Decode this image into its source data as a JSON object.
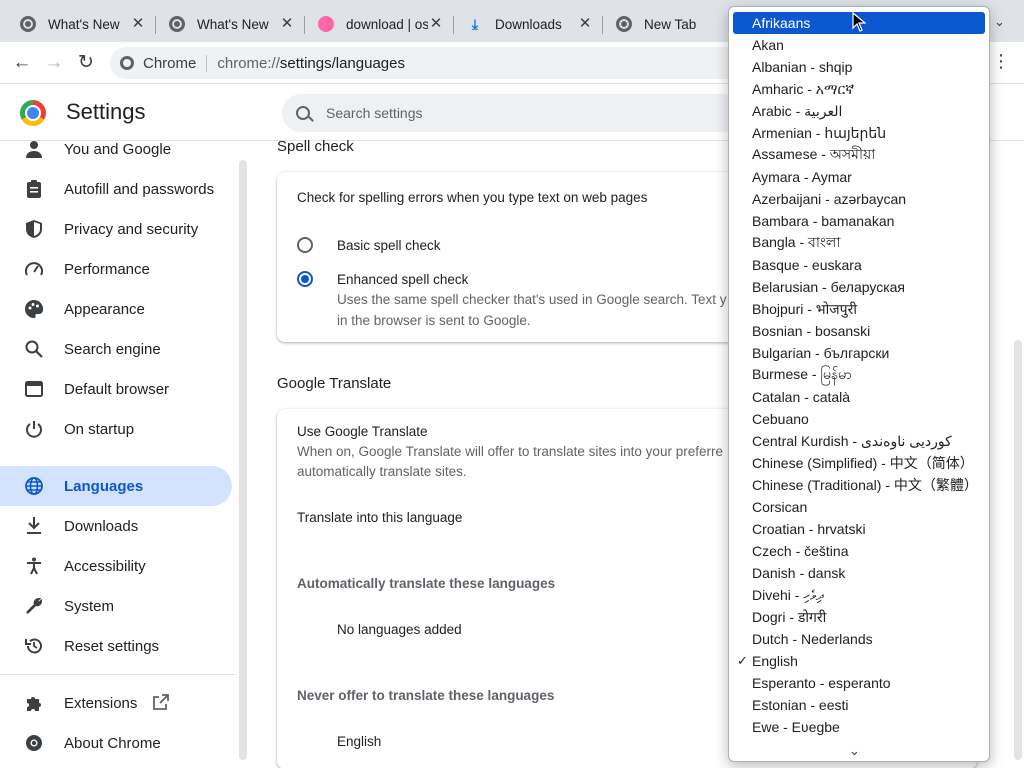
{
  "tabs": [
    {
      "title": "What's New",
      "favicon": "chrome-icon"
    },
    {
      "title": "What's New",
      "favicon": "chrome-icon"
    },
    {
      "title": "download | osu!",
      "favicon": "osu-icon"
    },
    {
      "title": "Downloads",
      "favicon": "download-icon"
    },
    {
      "title": "New Tab",
      "favicon": "chrome-icon"
    }
  ],
  "toolbar": {
    "chip": "Chrome",
    "url_prefix": "chrome://",
    "url_path": "settings/languages"
  },
  "header": {
    "title": "Settings",
    "search_placeholder": "Search settings"
  },
  "sidebar": {
    "items": [
      {
        "label": "You and Google",
        "icon": "person-icon"
      },
      {
        "label": "Autofill and passwords",
        "icon": "clipboard-icon"
      },
      {
        "label": "Privacy and security",
        "icon": "shield-icon"
      },
      {
        "label": "Performance",
        "icon": "gauge-icon"
      },
      {
        "label": "Appearance",
        "icon": "palette-icon"
      },
      {
        "label": "Search engine",
        "icon": "search-icon"
      },
      {
        "label": "Default browser",
        "icon": "browser-icon"
      },
      {
        "label": "On startup",
        "icon": "power-icon"
      },
      {
        "label": "Languages",
        "icon": "globe-icon"
      },
      {
        "label": "Downloads",
        "icon": "download-icon"
      },
      {
        "label": "Accessibility",
        "icon": "accessibility-icon"
      },
      {
        "label": "System",
        "icon": "wrench-icon"
      },
      {
        "label": "Reset settings",
        "icon": "history-icon"
      },
      {
        "label": "Extensions",
        "icon": "puzzle-icon"
      },
      {
        "label": "About Chrome",
        "icon": "chrome-icon"
      }
    ],
    "active": "Languages"
  },
  "spell_check": {
    "title": "Spell check",
    "description": "Check for spelling errors when you type text on web pages",
    "basic_label": "Basic spell check",
    "enhanced_label": "Enhanced spell check",
    "enhanced_desc_1": "Uses the same spell checker that's used in Google search. Text y",
    "enhanced_desc_2": "in the browser is sent to Google."
  },
  "translate": {
    "title": "Google Translate",
    "use_label": "Use Google Translate",
    "use_desc_1": "When on, Google Translate will offer to translate sites into your preferre",
    "use_desc_2": "automatically translate sites.",
    "into_label": "Translate into this language",
    "auto_header": "Automatically translate these languages",
    "auto_empty": "No languages added",
    "never_header": "Never offer to translate these languages",
    "never_item": "English"
  },
  "dropdown": {
    "options": [
      "Afrikaans",
      "Akan",
      "Albanian - shqip",
      "Amharic - አማርኛ",
      "Arabic - العربية",
      "Armenian - հայերեն",
      "Assamese - অসমীয়া",
      "Aymara - Aymar",
      "Azerbaijani - azərbaycan",
      "Bambara - bamanakan",
      "Bangla - বাংলা",
      "Basque - euskara",
      "Belarusian - беларуская",
      "Bhojpuri - भोजपुरी",
      "Bosnian - bosanski",
      "Bulgarian - български",
      "Burmese - မြန်မာ",
      "Catalan - català",
      "Cebuano",
      "Central Kurdish - کوردیی ناوەندی",
      "Chinese (Simplified) - 中文（简体）",
      "Chinese (Traditional) - 中文（繁體）",
      "Corsican",
      "Croatian - hrvatski",
      "Czech - čeština",
      "Danish - dansk",
      "Divehi - ދިވެހި",
      "Dogri - डोगरी",
      "Dutch - Nederlands",
      "English",
      "Esperanto - esperanto",
      "Estonian - eesti",
      "Ewe - Eʋegbe"
    ],
    "selected": "Afrikaans",
    "checked": "English"
  }
}
